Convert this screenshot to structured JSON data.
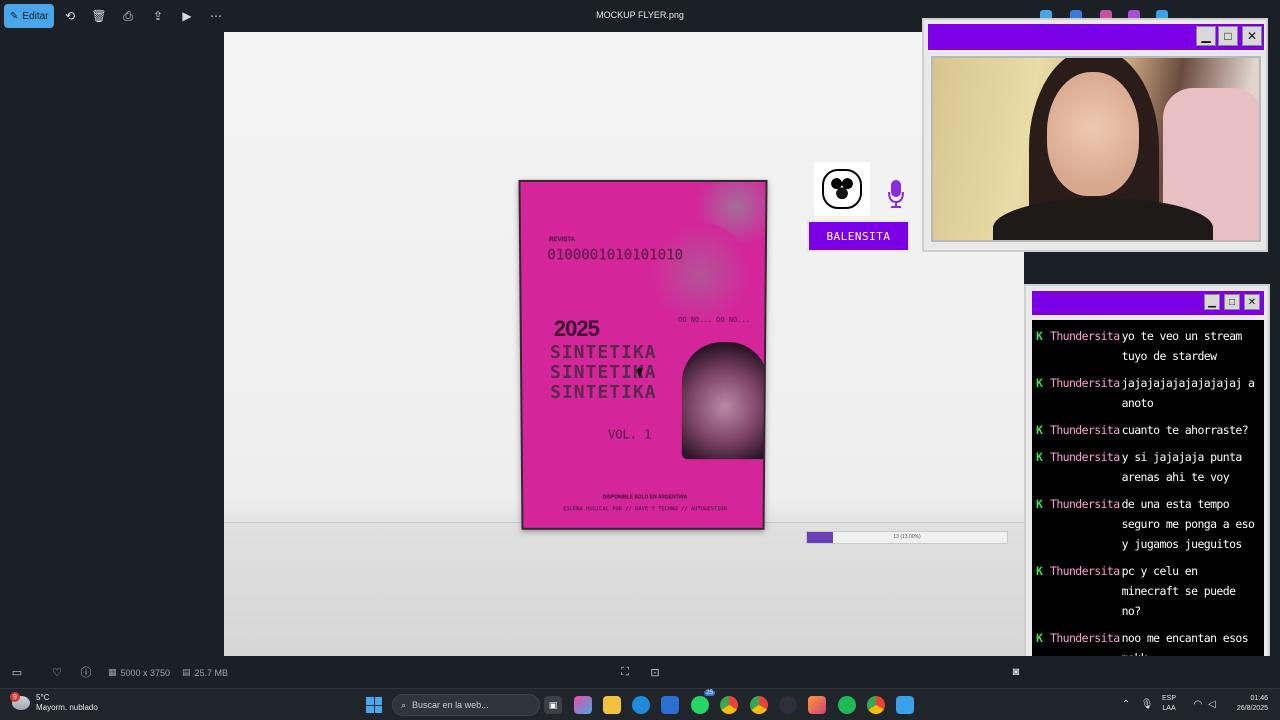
{
  "toolbar": {
    "edit_label": "Editar",
    "file_title": "MOCKUP FLYER.png",
    "icons": [
      "pencil-icon",
      "rotate-icon",
      "trash-icon",
      "print-icon",
      "share-icon",
      "slideshow-icon",
      "more-icon"
    ]
  },
  "poster": {
    "header": "REVISTA",
    "binary": "0100001010101010",
    "year": "2025",
    "lines": [
      "SINTETIKA",
      "SINTETIKA",
      "SINTETIKA"
    ],
    "vol": "VOL. 1",
    "ochoa": "OO NO... OO NO...",
    "foot1": "DISPONIBLE SOLO EN ARGENTINA",
    "foot2": "ESCENA MUSICAL FOR // RAVE Y TECHNO // AUTOGESTION"
  },
  "overlay": {
    "name": "BALENSITA",
    "progress_pct": 13,
    "progress_text": "13 (13.00%)"
  },
  "viewer_status": {
    "dimensions": "5000 x 3750",
    "size": "25.7 MB"
  },
  "chat": {
    "messages": [
      {
        "user": "Thundersita",
        "text": "yo te veo un stream tuyo de stardew"
      },
      {
        "user": "Thundersita",
        "text": "jajajajajajajajajaj a anoto"
      },
      {
        "user": "Thundersita",
        "text": "cuanto te ahorraste?"
      },
      {
        "user": "Thundersita",
        "text": "y si jajajaja punta arenas ahi te voy"
      },
      {
        "user": "Thundersita",
        "text": "de una esta tempo seguro me ponga a eso y jugamos jueguitos"
      },
      {
        "user": "Thundersita",
        "text": "pc y celu en minecraft se puede no?"
      },
      {
        "user": "Thundersita",
        "text": "noo me encantan esos mokk"
      }
    ]
  },
  "taskbar": {
    "weather_temp": "5°C",
    "weather_desc": "Mayorm. nublado",
    "weather_badge": "9",
    "search_placeholder": "Buscar en la web...",
    "whatsapp_badge": "25",
    "lang_top": "ESP",
    "lang_bottom": "LAA",
    "time": "01:46",
    "date": "26/8/2025"
  },
  "colors": {
    "accent": "#7c00e6",
    "poster_pink": "#d4259a",
    "chat_user": "#ff9fd4",
    "chat_badge": "#3ddc52"
  }
}
